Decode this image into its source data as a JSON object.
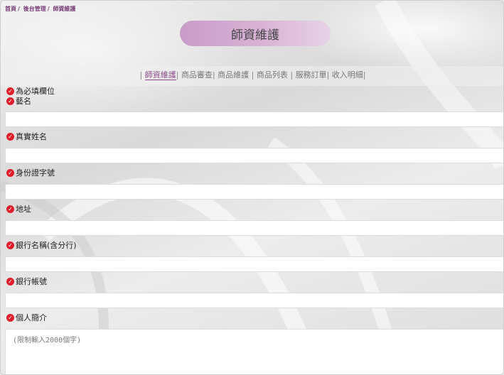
{
  "breadcrumb": [
    "首頁",
    "後台管理",
    "師資維護"
  ],
  "breadcrumb_separator": "/",
  "page_title": "師資維護",
  "tabs": [
    {
      "label": "師資維護",
      "active": true
    },
    {
      "label": "商品審查",
      "active": false
    },
    {
      "label": "商品維護",
      "active": false
    },
    {
      "label": "商品列表",
      "active": false
    },
    {
      "label": "服務訂單",
      "active": false
    },
    {
      "label": "收入明細",
      "active": false
    }
  ],
  "required_note": "為必填欄位",
  "fields": [
    {
      "label": "藝名",
      "value": ""
    },
    {
      "label": "真實姓名",
      "value": ""
    },
    {
      "label": "身份證字號",
      "value": ""
    },
    {
      "label": "地址",
      "value": ""
    },
    {
      "label": "銀行名稱(含分行)",
      "value": ""
    },
    {
      "label": "銀行帳號",
      "value": ""
    }
  ],
  "intro": {
    "label": "個人簡介",
    "placeholder": "(限制輸入2000個字)"
  },
  "colors": {
    "required": "#e01e2b",
    "accent": "#8a4a8a",
    "pill": "#c79bc7"
  },
  "icons": {
    "required": "check-circle-icon"
  }
}
